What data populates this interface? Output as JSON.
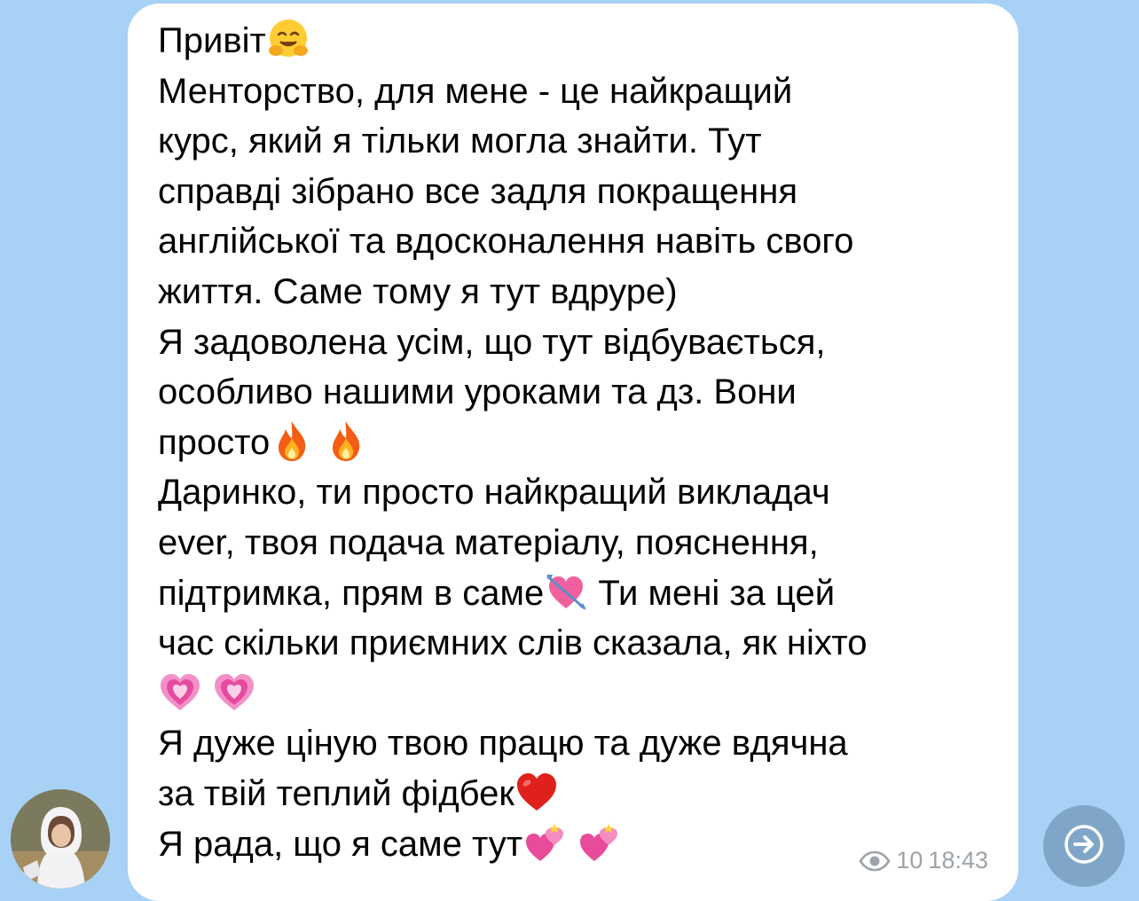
{
  "message": {
    "lines": [
      "Привіт",
      "Менторство, для мене - це найкращий",
      "курс, який я тільки могла знайти. Тут",
      "справді зібрано все задля покращення",
      "англійської та вдосконалення навіть свого",
      "життя. Саме тому я тут вдруре)",
      "Я задоволена усім, що тут відбувається,",
      "особливо нашими уроками та дз. Вони",
      "просто",
      "Даринко, ти просто найкращий викладач",
      "ever, твоя подача матеріалу, пояснення,",
      "підтримка, прям в саме",
      " Ти мені за цей",
      "час скільки приємних слів сказала, як ніхто",
      "Я дуже ціную твою працю та дуже вдячна",
      "за твій теплий фідбек",
      "Я рада, що я саме тут"
    ],
    "emojis": [
      "hugging-face",
      "fire",
      "heart-with-arrow",
      "growing-heart",
      "red-heart",
      "two-hearts"
    ]
  },
  "meta": {
    "views": "10",
    "time": "18:43",
    "views_icon": "eye-icon"
  },
  "share_icon": "share-arrow-icon",
  "colors": {
    "background": "#a8d2f5",
    "bubble": "#ffffff",
    "meta_text": "#9da3a9",
    "share_button": "#7fa6c8"
  }
}
